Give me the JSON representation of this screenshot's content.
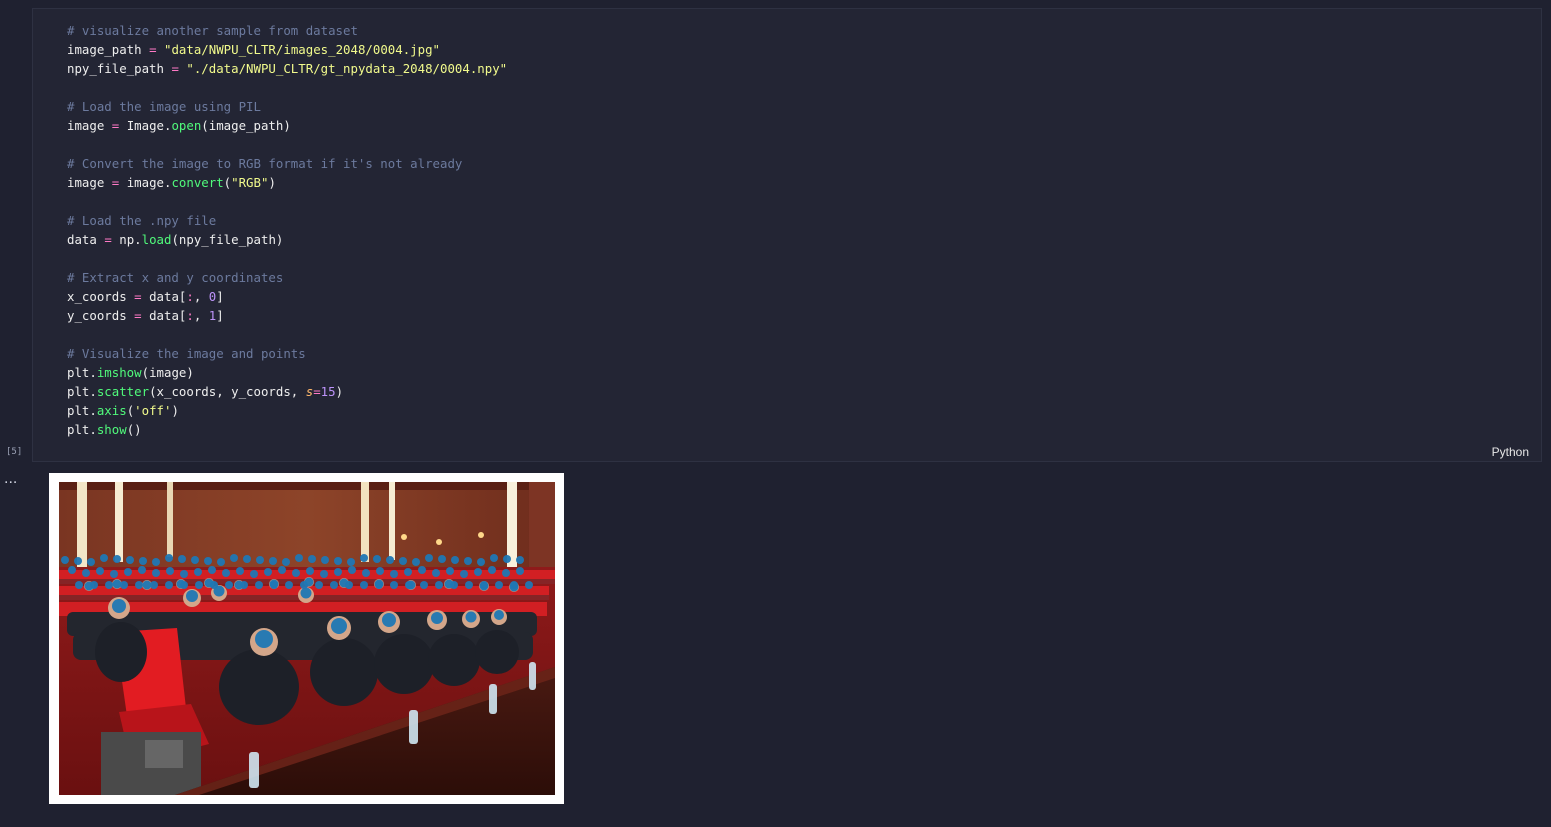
{
  "cell": {
    "execution_count": "[5]",
    "language": "Python",
    "code_lines": [
      [
        {
          "t": "# visualize another sample from dataset",
          "k": "c"
        }
      ],
      [
        {
          "t": "image_path ",
          "k": ""
        },
        {
          "t": "=",
          "k": "o"
        },
        {
          "t": " ",
          "k": ""
        },
        {
          "t": "\"data/NWPU_CLTR/images_2048/0004.jpg\"",
          "k": "s"
        }
      ],
      [
        {
          "t": "npy_file_path ",
          "k": ""
        },
        {
          "t": "=",
          "k": "o"
        },
        {
          "t": " ",
          "k": ""
        },
        {
          "t": "\"./data/NWPU_CLTR/gt_npydata_2048/0004.npy\"",
          "k": "s"
        }
      ],
      [],
      [
        {
          "t": "# Load the image using PIL",
          "k": "c"
        }
      ],
      [
        {
          "t": "image ",
          "k": ""
        },
        {
          "t": "=",
          "k": "o"
        },
        {
          "t": " Image.",
          "k": ""
        },
        {
          "t": "open",
          "k": "f"
        },
        {
          "t": "(image_path)",
          "k": ""
        }
      ],
      [],
      [
        {
          "t": "# Convert the image to RGB format if it's not already",
          "k": "c"
        }
      ],
      [
        {
          "t": "image ",
          "k": ""
        },
        {
          "t": "=",
          "k": "o"
        },
        {
          "t": " image.",
          "k": ""
        },
        {
          "t": "convert",
          "k": "f"
        },
        {
          "t": "(",
          "k": ""
        },
        {
          "t": "\"RGB\"",
          "k": "s"
        },
        {
          "t": ")",
          "k": ""
        }
      ],
      [],
      [
        {
          "t": "# Load the .npy file",
          "k": "c"
        }
      ],
      [
        {
          "t": "data ",
          "k": ""
        },
        {
          "t": "=",
          "k": "o"
        },
        {
          "t": " np.",
          "k": ""
        },
        {
          "t": "load",
          "k": "f"
        },
        {
          "t": "(npy_file_path)",
          "k": ""
        }
      ],
      [],
      [
        {
          "t": "# Extract x and y coordinates",
          "k": "c"
        }
      ],
      [
        {
          "t": "x_coords ",
          "k": ""
        },
        {
          "t": "=",
          "k": "o"
        },
        {
          "t": " data[",
          "k": ""
        },
        {
          "t": ":",
          "k": "o"
        },
        {
          "t": ", ",
          "k": ""
        },
        {
          "t": "0",
          "k": "n"
        },
        {
          "t": "]",
          "k": ""
        }
      ],
      [
        {
          "t": "y_coords ",
          "k": ""
        },
        {
          "t": "=",
          "k": "o"
        },
        {
          "t": " data[",
          "k": ""
        },
        {
          "t": ":",
          "k": "o"
        },
        {
          "t": ", ",
          "k": ""
        },
        {
          "t": "1",
          "k": "n"
        },
        {
          "t": "]",
          "k": ""
        }
      ],
      [],
      [
        {
          "t": "# Visualize the image and points",
          "k": "c"
        }
      ],
      [
        {
          "t": "plt.",
          "k": ""
        },
        {
          "t": "imshow",
          "k": "f"
        },
        {
          "t": "(image)",
          "k": ""
        }
      ],
      [
        {
          "t": "plt.",
          "k": ""
        },
        {
          "t": "scatter",
          "k": "f"
        },
        {
          "t": "(x_coords, y_coords, ",
          "k": ""
        },
        {
          "t": "s",
          "k": "p"
        },
        {
          "t": "=",
          "k": "o"
        },
        {
          "t": "15",
          "k": "n"
        },
        {
          "t": ")",
          "k": ""
        }
      ],
      [
        {
          "t": "plt.",
          "k": ""
        },
        {
          "t": "axis",
          "k": "f"
        },
        {
          "t": "(",
          "k": ""
        },
        {
          "t": "'off'",
          "k": "s"
        },
        {
          "t": ")",
          "k": ""
        }
      ],
      [
        {
          "t": "plt.",
          "k": ""
        },
        {
          "t": "show",
          "k": "f"
        },
        {
          "t": "()",
          "k": ""
        }
      ]
    ]
  },
  "output": {
    "more_label": "...",
    "marker_color": "#1f77b4"
  }
}
